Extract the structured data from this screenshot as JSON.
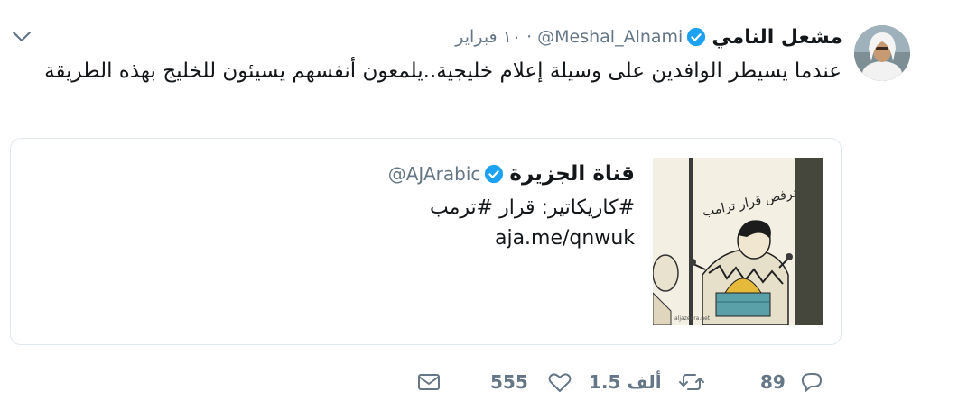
{
  "tweet": {
    "author_name": "مشعل النامي",
    "author_handle": "@Meshal_Alnami",
    "separator": "·",
    "time": "١٠ فبراير",
    "text": "عندما يسيطر الوافدين على وسيلة إعلام خليجية..يلمعون أنفسهم يسيئون للخليج بهذه الطريقة"
  },
  "quoted": {
    "author_name": "قناة الجزيرة",
    "author_handle": "@AJArabic",
    "line1": "#كاريكاتير: قرار #ترمب",
    "line2": "aja.me/qnwuk",
    "media": {
      "caption": "نرفض قرار ترامب",
      "signature": "aljazeera.net"
    }
  },
  "actions": {
    "reply_count": "89",
    "retweet_count": "1.5 ألف",
    "like_count": "555"
  },
  "colors": {
    "verified": "#1da1f2",
    "secondary_text": "#657786",
    "border": "#e1e8ed"
  },
  "icons": {
    "caret": "chevron-down-icon",
    "verified": "verified-badge-icon",
    "reply": "reply-icon",
    "retweet": "retweet-icon",
    "like": "heart-icon",
    "message": "envelope-icon"
  }
}
